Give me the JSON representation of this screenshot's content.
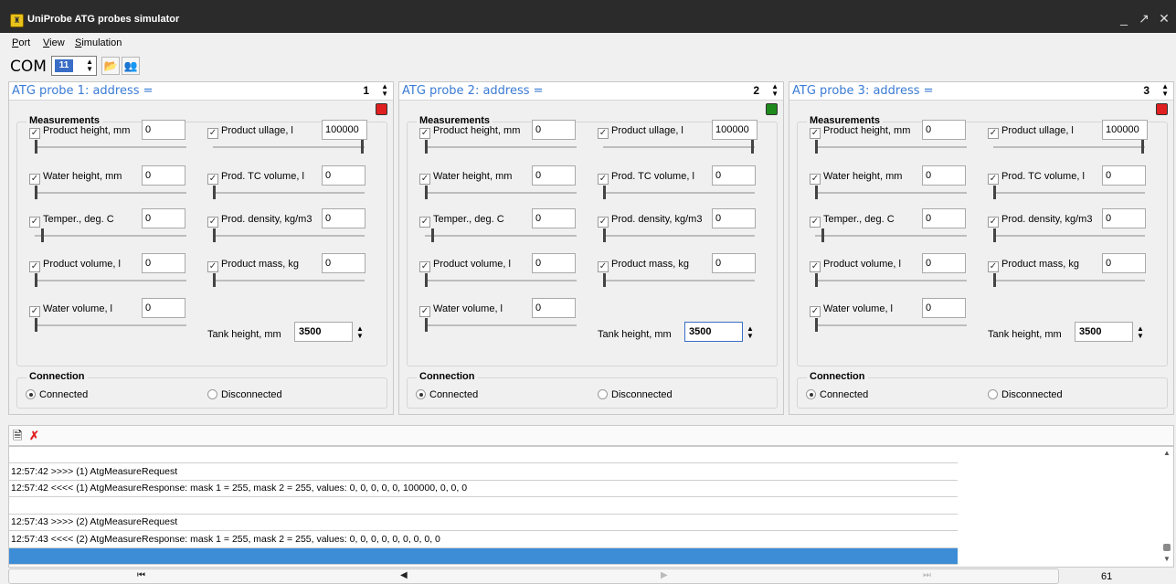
{
  "window": {
    "title": "UniProbe ATG probes simulator",
    "minimize": "_",
    "maximize": "↗",
    "close": "✕"
  },
  "menu": [
    {
      "ul": "P",
      "rest": "ort"
    },
    {
      "ul": "V",
      "rest": "iew"
    },
    {
      "ul": "S",
      "rest": "imulation"
    }
  ],
  "toolbar": {
    "com_label": "COM",
    "com_port": "11"
  },
  "labels": {
    "measurements": "Measurements",
    "connection": "Connection",
    "connected": "Connected",
    "disconnected": "Disconnected",
    "tank_height": "Tank height, mm",
    "product_height": "Product height, mm",
    "product_ullage": "Product ullage, l",
    "water_height": "Water height, mm",
    "prod_tc_volume": "Prod. TC volume, l",
    "temper": "Temper., deg. C",
    "prod_density": "Prod. density, kg/m3",
    "product_volume": "Product volume, l",
    "product_mass": "Product mass, kg",
    "water_volume": "Water volume, l"
  },
  "probes": [
    {
      "title": "ATG probe 1: address =",
      "address": "1",
      "status_color": "#e02020",
      "connected": true,
      "product_height": "0",
      "product_ullage": "100000",
      "water_height": "0",
      "prod_tc_volume": "0",
      "temper": "0",
      "prod_density": "0",
      "product_volume": "0",
      "product_mass": "0",
      "water_volume": "0",
      "tank_height": "3500"
    },
    {
      "title": "ATG probe 2: address =",
      "address": "2",
      "status_color": "#1e8a1e",
      "connected": true,
      "product_height": "0",
      "product_ullage": "100000",
      "water_height": "0",
      "prod_tc_volume": "0",
      "temper": "0",
      "prod_density": "0",
      "product_volume": "0",
      "product_mass": "0",
      "water_volume": "0",
      "tank_height": "3500"
    },
    {
      "title": "ATG probe 3: address =",
      "address": "3",
      "status_color": "#e02020",
      "connected": true,
      "product_height": "0",
      "product_ullage": "100000",
      "water_height": "0",
      "prod_tc_volume": "0",
      "temper": "0",
      "prod_density": "0",
      "product_volume": "0",
      "product_mass": "0",
      "water_volume": "0",
      "tank_height": "3500"
    }
  ],
  "log": [
    "",
    "12:57:42 >>>> (1) AtgMeasureRequest",
    "12:57:42 <<<< (1) AtgMeasureResponse: mask 1 = 255, mask 2 = 255, values: 0, 0, 0, 0, 0, 100000, 0, 0, 0",
    "",
    "12:57:43 >>>> (2) AtgMeasureRequest",
    "12:57:43 <<<< (2) AtgMeasureResponse: mask 1 = 255, mask 2 = 255, values: 0, 0, 0, 0, 0, 0, 0, 0, 0",
    ""
  ],
  "status": {
    "count": "61"
  }
}
